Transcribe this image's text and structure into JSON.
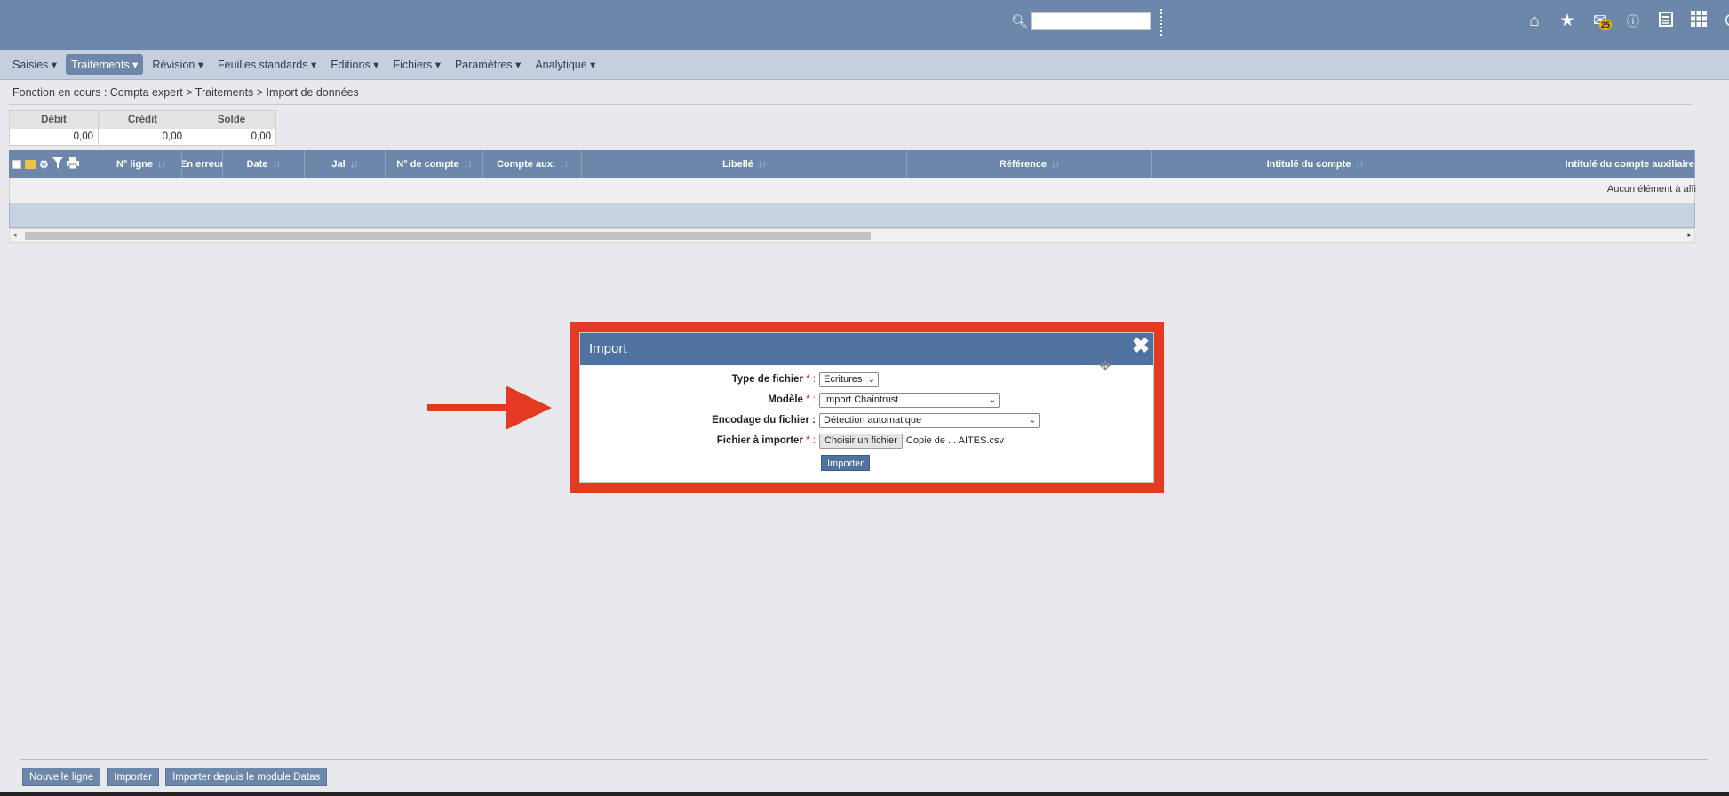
{
  "header": {
    "search": {
      "value": "",
      "placeholder": ""
    },
    "icons": [
      "home-icon",
      "star-icon",
      "mail-icon",
      "help-icon",
      "calendar-icon",
      "apps-icon",
      "power-icon"
    ],
    "mail_badge": "25"
  },
  "menu": {
    "items": [
      {
        "label": "Saisies"
      },
      {
        "label": "Traitements",
        "active": true
      },
      {
        "label": "Révision"
      },
      {
        "label": "Feuilles standards"
      },
      {
        "label": "Editions"
      },
      {
        "label": "Fichiers"
      },
      {
        "label": "Paramètres"
      },
      {
        "label": "Analytique"
      }
    ]
  },
  "breadcrumb": "Fonction en cours : Compta expert > Traitements > Import de données",
  "totals": [
    {
      "label": "Débit",
      "value": "0,00"
    },
    {
      "label": "Crédit",
      "value": "0,00"
    },
    {
      "label": "Solde",
      "value": "0,00"
    }
  ],
  "grid": {
    "columns": [
      {
        "label": "N° ligne",
        "sort": "↓↑"
      },
      {
        "label": "En erreur",
        "sort": ""
      },
      {
        "label": "Date",
        "sort": "↓↑"
      },
      {
        "label": "Jal",
        "sort": "↓↑"
      },
      {
        "label": "N° de compte",
        "sort": "↓↑"
      },
      {
        "label": "Compte aux.",
        "sort": "↓↑"
      },
      {
        "label": "Libellé",
        "sort": "↓↑"
      },
      {
        "label": "Référence",
        "sort": "↓↑"
      },
      {
        "label": "Intitulé du compte",
        "sort": "↓↑"
      },
      {
        "label": "Intitulé du compte auxiliaire",
        "sort": ""
      }
    ],
    "empty_message": "Aucun élément à affi"
  },
  "modal": {
    "title": "Import",
    "fields": {
      "type_label": "Type de fichier",
      "type_value": "Ecritures",
      "model_label": "Modèle",
      "model_value": "Import Chaintrust",
      "encoding_label": "Encodage du fichier :",
      "encoding_value": "Détection automatique",
      "file_label": "Fichier à importer",
      "file_button": "Choisir un fichier",
      "file_name": "Copie de ... AITES.csv"
    },
    "required_mark": "* :",
    "submit": "Importer"
  },
  "footer": {
    "buttons": [
      "Nouvelle ligne",
      "Importer",
      "Importer depuis le module Datas"
    ]
  },
  "colors": {
    "header": "#6d87aa",
    "menubar": "#c5cfe0",
    "highlight": "#e53a22",
    "modal_header": "#4f72a0"
  }
}
